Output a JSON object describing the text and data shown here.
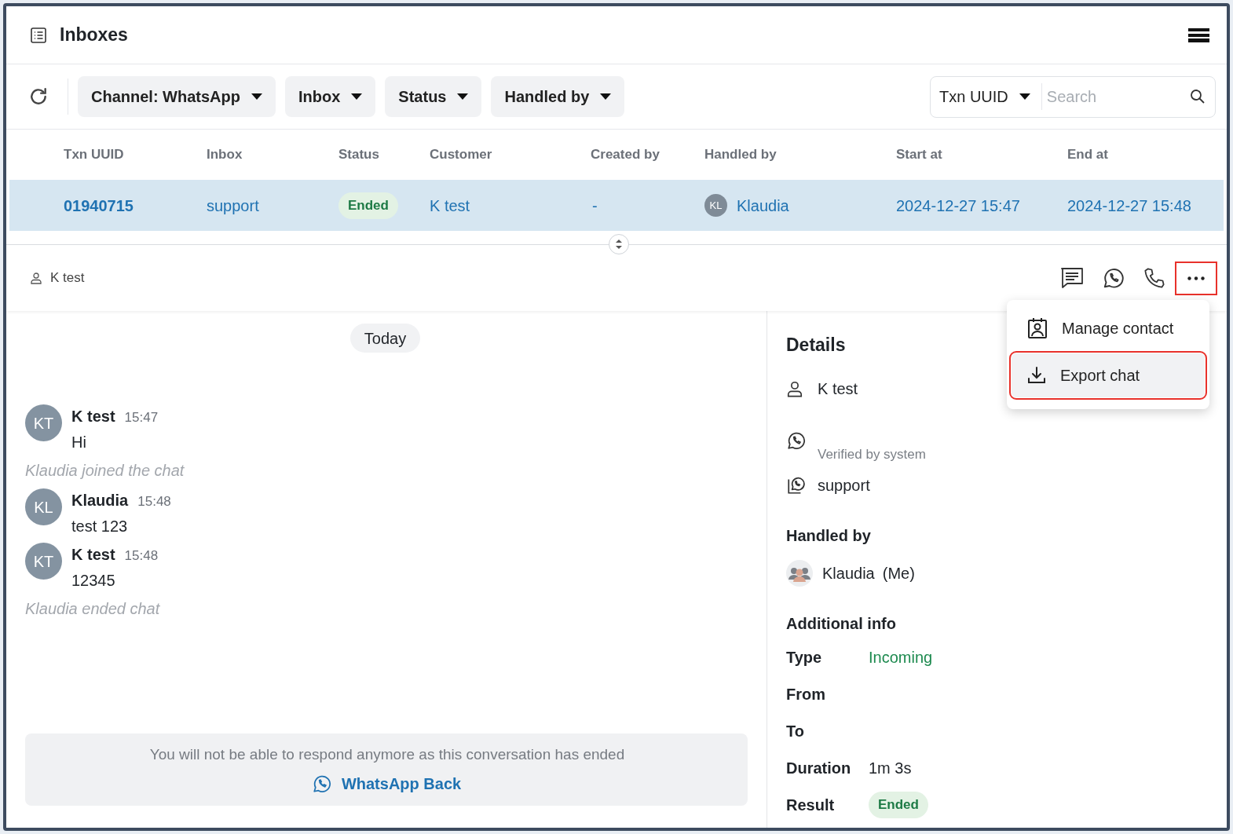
{
  "header": {
    "title": "Inboxes"
  },
  "toolbar": {
    "filters": [
      {
        "label": "**Channel:** WhatsApp"
      },
      {
        "label": "Inbox"
      },
      {
        "label": "Status"
      },
      {
        "label": "Handled by"
      }
    ],
    "search": {
      "field": "Txn UUID",
      "placeholder": "Search"
    }
  },
  "table": {
    "columns": [
      "Txn UUID",
      "Inbox",
      "Status",
      "Customer",
      "Created by",
      "Handled by",
      "Start at",
      "End at"
    ],
    "rows": [
      {
        "selected": true,
        "txn_uuid": "01940715",
        "inbox": "support",
        "status": "Ended",
        "customer": "K test",
        "created_by": "-",
        "handled_by": {
          "initials": "KL",
          "name": "Klaudia"
        },
        "start_at": "2024-12-27 15:47",
        "end_at": "2024-12-27 15:48"
      }
    ]
  },
  "contact_bar": {
    "name": "K test",
    "more_highlighted": true
  },
  "menu": {
    "items": [
      {
        "kind": "contact",
        "label": "Manage contact",
        "highlighted": false
      },
      {
        "kind": "export",
        "label": "Export chat",
        "highlighted": true
      }
    ]
  },
  "chat": {
    "date": "Today",
    "entries": [
      {
        "kind": "message",
        "initials": "KT",
        "author": "K test",
        "time": "15:47",
        "text": "Hi"
      },
      {
        "kind": "event",
        "text": "Klaudia joined the chat"
      },
      {
        "kind": "message",
        "initials": "KL",
        "author": "Klaudia",
        "time": "15:48",
        "text": "test 123"
      },
      {
        "kind": "message",
        "initials": "KT",
        "author": "K test",
        "time": "15:48",
        "text": "12345"
      },
      {
        "kind": "event",
        "text": "Klaudia ended chat"
      }
    ],
    "notice": {
      "text": "You will not be able to respond anymore as this conversation has ended",
      "link": "WhatsApp Back"
    }
  },
  "details": {
    "title": "Details",
    "contact": "K test",
    "verified": "Verified by system",
    "inbox": "support",
    "handled_by_title": "Handled by",
    "agent": {
      "name": "Klaudia",
      "suffix": "(Me)"
    },
    "additional_title": "Additional info",
    "fields": [
      {
        "label": "Type",
        "kind": "accent",
        "value": "Incoming"
      },
      {
        "label": "From"
      },
      {
        "label": "To"
      },
      {
        "label": "Duration",
        "kind": "plain",
        "value": "1m 3s"
      },
      {
        "label": "Result",
        "kind": "badge",
        "value": "Ended"
      }
    ]
  }
}
